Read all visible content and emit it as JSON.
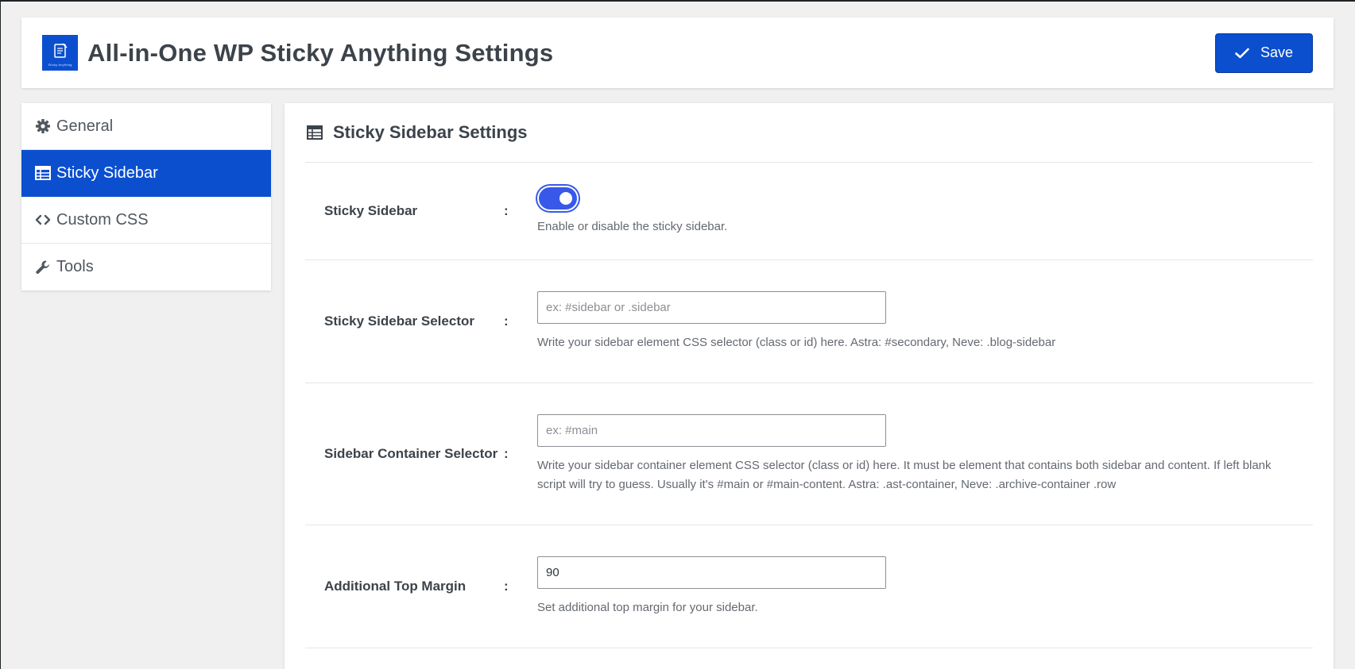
{
  "header": {
    "logo_text": "Sticky Anything",
    "title": "All-in-One WP Sticky Anything Settings",
    "save_label": "Save"
  },
  "sidebar": {
    "items": [
      {
        "label": "General",
        "icon": "gear-icon",
        "active": false
      },
      {
        "label": "Sticky Sidebar",
        "icon": "table-icon",
        "active": true
      },
      {
        "label": "Custom CSS",
        "icon": "code-icon",
        "active": false
      },
      {
        "label": "Tools",
        "icon": "wrench-icon",
        "active": false
      }
    ]
  },
  "main": {
    "section_title": "Sticky Sidebar Settings",
    "fields": [
      {
        "label": "Sticky Sidebar",
        "type": "toggle",
        "enabled": true,
        "description": "Enable or disable the sticky sidebar."
      },
      {
        "label": "Sticky Sidebar Selector",
        "type": "text",
        "value": "",
        "placeholder": "ex: #sidebar or .sidebar",
        "description": "Write your sidebar element CSS selector (class or id) here. Astra: #secondary, Neve: .blog-sidebar"
      },
      {
        "label": "Sidebar Container Selector",
        "type": "text",
        "value": "",
        "placeholder": "ex: #main",
        "description": "Write your sidebar container element CSS selector (class or id) here. It must be element that contains both sidebar and content. If left blank script will try to guess. Usually it's #main or #main-content. Astra: .ast-container, Neve: .archive-container .row"
      },
      {
        "label": "Additional Top Margin",
        "type": "text",
        "value": "90",
        "placeholder": "",
        "description": "Set additional top margin for your sidebar."
      }
    ],
    "colon": ":"
  },
  "colors": {
    "accent": "#0b4fcf",
    "toggle": "#3858e9"
  }
}
